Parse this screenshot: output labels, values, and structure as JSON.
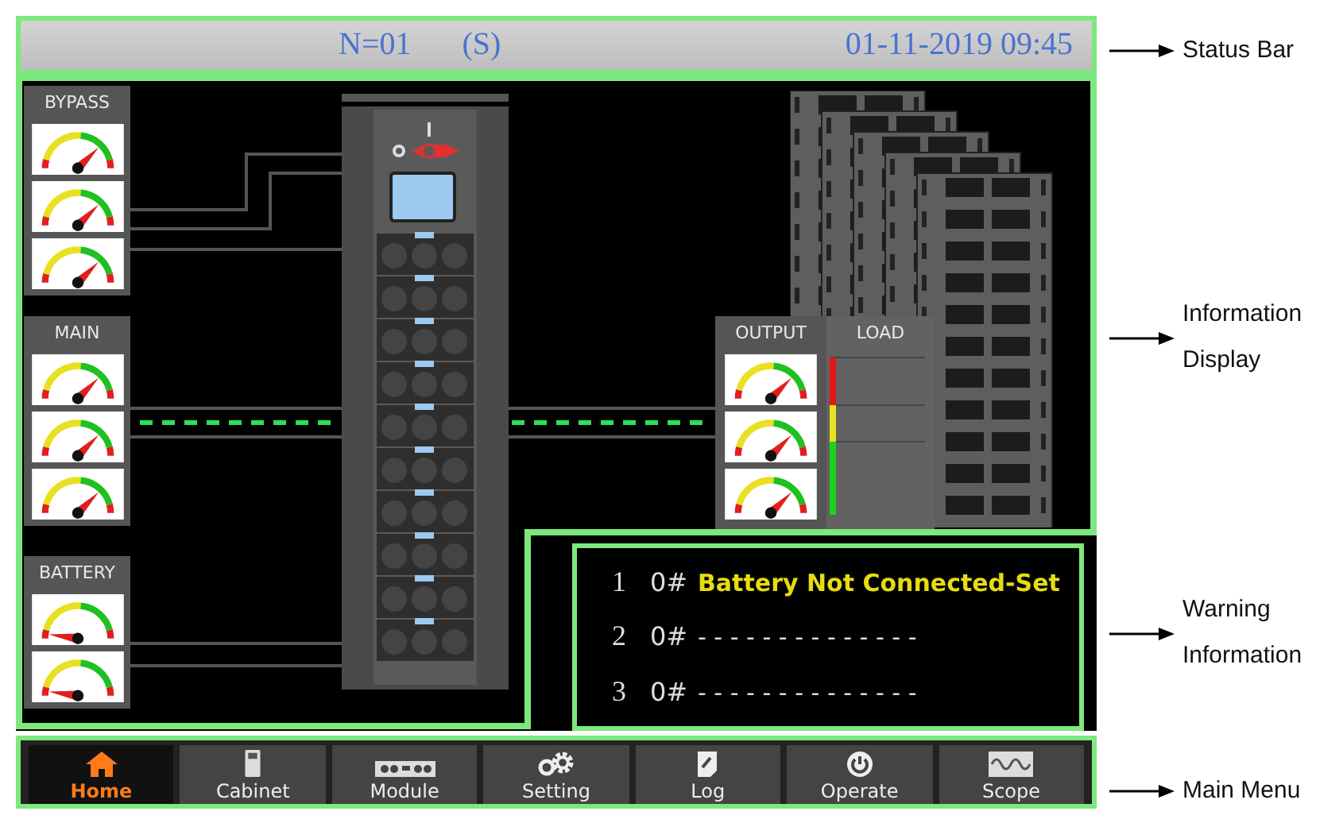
{
  "status_bar": {
    "unit": "N=01",
    "mode": "(S)",
    "datetime": "01-11-2019 09:45"
  },
  "input_panels": [
    {
      "title": "BYPASS",
      "gauges": [
        {
          "kind": "dial_high"
        },
        {
          "kind": "dial_high"
        },
        {
          "kind": "dial_high"
        }
      ]
    },
    {
      "title": "MAIN",
      "gauges": [
        {
          "kind": "dial_high"
        },
        {
          "kind": "dial_high"
        },
        {
          "kind": "dial_high"
        }
      ]
    },
    {
      "title": "BATTERY",
      "gauges": [
        {
          "kind": "dial_low"
        },
        {
          "kind": "dial_low"
        }
      ]
    }
  ],
  "output_panel": {
    "title": "OUTPUT",
    "gauges": [
      {
        "kind": "dial_high"
      },
      {
        "kind": "dial_high"
      },
      {
        "kind": "dial_high"
      }
    ]
  },
  "load_panel": {
    "title": "LOAD"
  },
  "warnings": [
    {
      "index": "1",
      "code": "0#",
      "message": "Battery Not Connected-Set",
      "kind": "alert"
    },
    {
      "index": "2",
      "code": "0#",
      "message": "- - - - - - - - - - - - - -",
      "kind": "empty"
    },
    {
      "index": "3",
      "code": "0#",
      "message": "- - - - - - - - - - - - - -",
      "kind": "empty"
    }
  ],
  "menu": [
    {
      "label": "Home",
      "selected": true
    },
    {
      "label": "Cabinet",
      "selected": false
    },
    {
      "label": "Module",
      "selected": false
    },
    {
      "label": "Setting",
      "selected": false
    },
    {
      "label": "Log",
      "selected": false
    },
    {
      "label": "Operate",
      "selected": false
    },
    {
      "label": "Scope",
      "selected": false
    }
  ],
  "callouts": [
    {
      "label": "Status Bar"
    },
    {
      "label": "Information Display"
    },
    {
      "label": "Warning Information"
    },
    {
      "label": "Main Menu"
    }
  ]
}
